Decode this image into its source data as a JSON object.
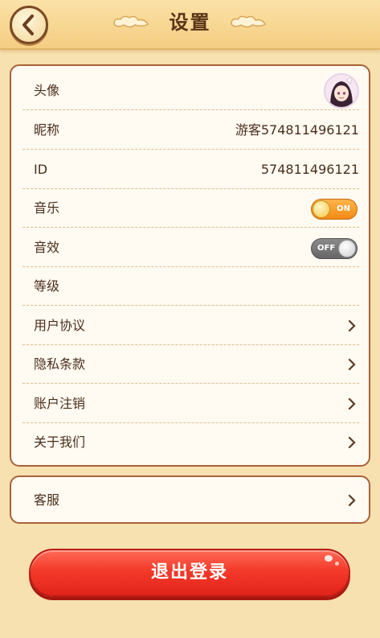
{
  "header": {
    "title": "设置"
  },
  "settings": {
    "avatar_label": "头像",
    "nickname_label": "昵称",
    "nickname_value": "游客574811496121",
    "id_label": "ID",
    "id_value": "574811496121",
    "music_label": "音乐",
    "music_toggle": "ON",
    "sound_label": "音效",
    "sound_toggle": "OFF",
    "level_label": "等级",
    "agreement_label": "用户协议",
    "privacy_label": "隐私条款",
    "cancel_account_label": "账户注销",
    "about_label": "关于我们"
  },
  "service": {
    "label": "客服"
  },
  "logout": {
    "label": "退出登录"
  },
  "colors": {
    "accent": "#f28a15",
    "logout": "#f43a2a",
    "border": "#a8623a"
  }
}
